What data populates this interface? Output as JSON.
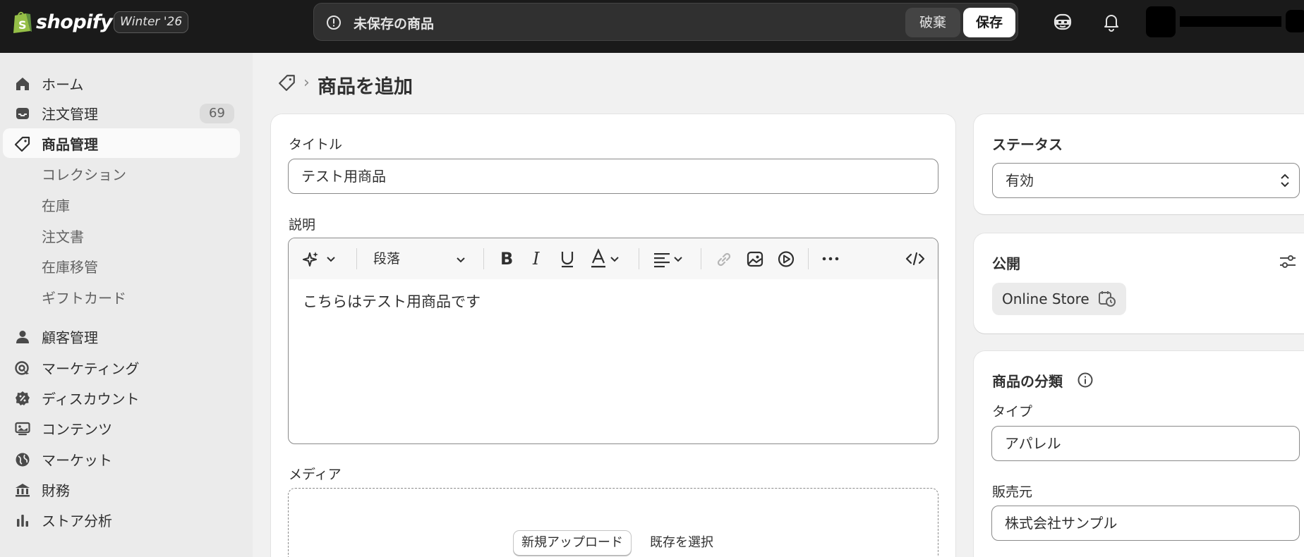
{
  "topbar": {
    "brand": "shopify",
    "version": "Winter '26",
    "unsaved_text": "未保存の商品",
    "discard_label": "破棄",
    "save_label": "保存"
  },
  "sidebar": {
    "items": [
      {
        "label": "ホーム",
        "icon": "home-icon"
      },
      {
        "label": "注文管理",
        "icon": "inbox-icon",
        "badge": "69"
      },
      {
        "label": "商品管理",
        "icon": "tag-icon",
        "active": true
      },
      {
        "label": "コレクション",
        "sub": true
      },
      {
        "label": "在庫",
        "sub": true
      },
      {
        "label": "注文書",
        "sub": true
      },
      {
        "label": "在庫移管",
        "sub": true
      },
      {
        "label": "ギフトカード",
        "sub": true
      },
      {
        "label": "顧客管理",
        "icon": "person-icon"
      },
      {
        "label": "マーケティング",
        "icon": "target-icon"
      },
      {
        "label": "ディスカウント",
        "icon": "discount-icon"
      },
      {
        "label": "コンテンツ",
        "icon": "content-icon"
      },
      {
        "label": "マーケット",
        "icon": "globe-icon"
      },
      {
        "label": "財務",
        "icon": "bank-icon"
      },
      {
        "label": "ストア分析",
        "icon": "chart-icon"
      }
    ]
  },
  "page": {
    "title": "商品を追加"
  },
  "product": {
    "title_label": "タイトル",
    "title_value": "テスト用商品",
    "description_label": "説明",
    "paragraph_style": "段落",
    "description_value": "こちらはテスト用商品です",
    "media_label": "メディア",
    "upload_label": "新規アップロード",
    "select_existing_label": "既存を選択"
  },
  "status": {
    "title": "ステータス",
    "value": "有効"
  },
  "publishing": {
    "title": "公開",
    "channel": "Online Store"
  },
  "organization": {
    "title": "商品の分類",
    "type_label": "タイプ",
    "type_value": "アパレル",
    "vendor_label": "販売元",
    "vendor_value": "株式会社サンプル"
  },
  "colors": {
    "topbar_bg": "#1a1a1a",
    "page_bg": "#f1f1f1",
    "sidebar_bg": "#ebebeb",
    "brand_green": "#95bf47"
  }
}
